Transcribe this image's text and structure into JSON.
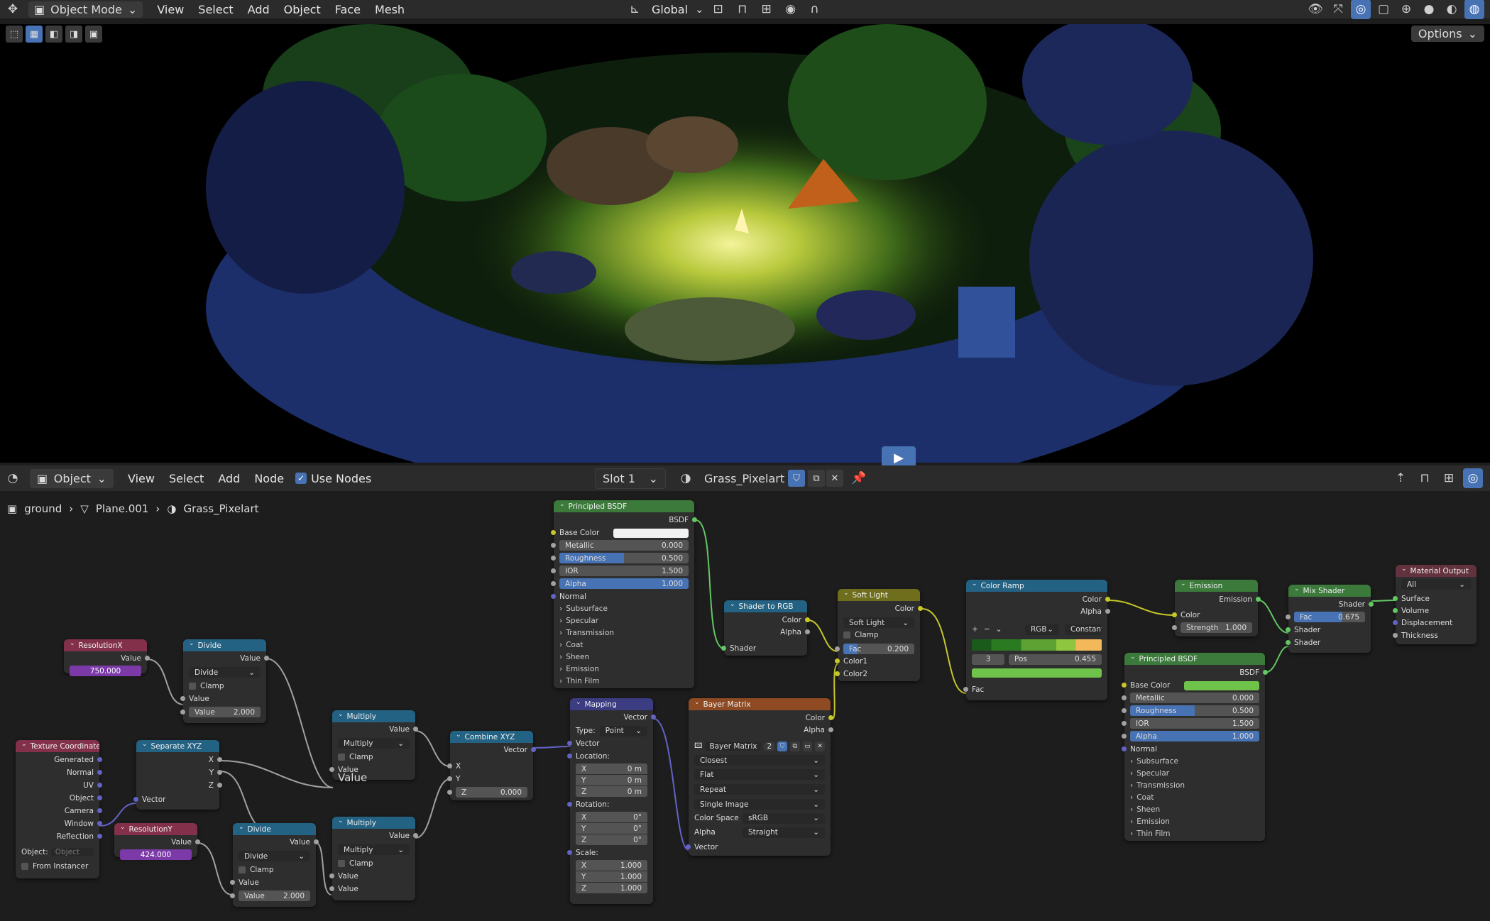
{
  "top_header": {
    "mode": "Object Mode",
    "menus": [
      "View",
      "Select",
      "Add",
      "Object",
      "Face",
      "Mesh"
    ],
    "transform_orientation": "Global",
    "options": "Options"
  },
  "node_header": {
    "mode": "Object",
    "menus": [
      "View",
      "Select",
      "Add",
      "Node"
    ],
    "use_nodes": "Use Nodes",
    "slot": "Slot 1",
    "material": "Grass_Pixelart"
  },
  "breadcrumb": {
    "object": "ground",
    "mesh": "Plane.001",
    "material": "Grass_Pixelart"
  },
  "nodes": {
    "resx": {
      "title": "ResolutionX",
      "out": "Value",
      "value": "750.000"
    },
    "resy": {
      "title": "ResolutionY",
      "out": "Value",
      "value": "424.000"
    },
    "texcoord": {
      "title": "Texture Coordinate",
      "outputs": [
        "Generated",
        "Normal",
        "UV",
        "Object",
        "Camera",
        "Window",
        "Reflection"
      ],
      "object_label": "Object:",
      "object_placeholder": "Object",
      "from_instancer": "From Instancer"
    },
    "sepxyz": {
      "title": "Separate XYZ",
      "outputs": [
        "X",
        "Y",
        "Z"
      ],
      "input": "Vector"
    },
    "div1": {
      "title": "Divide",
      "out": "Value",
      "op": "Divide",
      "clamp": "Clamp",
      "in1": "Value",
      "in2": "Value",
      "val2": "2.000"
    },
    "div2": {
      "title": "Divide",
      "out": "Value",
      "op": "Divide",
      "clamp": "Clamp",
      "in1": "Value",
      "in2": "Value",
      "val2": "2.000"
    },
    "mul1": {
      "title": "Multiply",
      "out": "Value",
      "op": "Multiply",
      "clamp": "Clamp",
      "in1": "Value",
      "in2": "Value"
    },
    "mul2": {
      "title": "Multiply",
      "out": "Value",
      "op": "Multiply",
      "clamp": "Clamp",
      "in1": "Value",
      "in2": "Value"
    },
    "combxyz": {
      "title": "Combine XYZ",
      "out": "Vector",
      "x": "X",
      "y": "Y",
      "z": "Z",
      "zval": "0.000"
    },
    "mapping": {
      "title": "Mapping",
      "out": "Vector",
      "type_label": "Type:",
      "type": "Point",
      "vector": "Vector",
      "location": "Location:",
      "rotation": "Rotation:",
      "scale": "Scale:",
      "loc": [
        "0 m",
        "0 m",
        "0 m"
      ],
      "rot": [
        "0°",
        "0°",
        "0°"
      ],
      "scl": [
        "1.000",
        "1.000",
        "1.000"
      ],
      "axes": [
        "X",
        "Y",
        "Z"
      ]
    },
    "bsdf1": {
      "title": "Principled BSDF",
      "out": "BSDF",
      "base_color": "Base Color",
      "metallic": "Metallic",
      "metallic_v": "0.000",
      "roughness": "Roughness",
      "roughness_v": "0.500",
      "ior": "IOR",
      "ior_v": "1.500",
      "alpha": "Alpha",
      "alpha_v": "1.000",
      "normal": "Normal",
      "panels": [
        "Subsurface",
        "Specular",
        "Transmission",
        "Coat",
        "Sheen",
        "Emission",
        "Thin Film"
      ]
    },
    "s2rgb": {
      "title": "Shader to RGB",
      "color": "Color",
      "alpha": "Alpha",
      "shader": "Shader"
    },
    "bayer": {
      "title": "Bayer Matrix",
      "color": "Color",
      "alpha": "Alpha",
      "image": "Bayer Matrix",
      "users": "2",
      "interp": "Closest",
      "proj": "Flat",
      "ext": "Repeat",
      "source": "Single Image",
      "cs_label": "Color Space",
      "cs": "sRGB",
      "alpha_label": "Alpha",
      "alpha_mode": "Straight",
      "vector": "Vector"
    },
    "softlight": {
      "title": "Soft Light",
      "color": "Color",
      "mode": "Soft Light",
      "clamp": "Clamp",
      "fac": "Fac",
      "fac_v": "0.200",
      "c1": "Color1",
      "c2": "Color2"
    },
    "ramp": {
      "title": "Color Ramp",
      "color": "Color",
      "alpha": "Alpha",
      "plus": "+",
      "minus": "−",
      "mode": "RGB",
      "interp": "Constant",
      "idx": "3",
      "pos_label": "Pos",
      "pos": "0.455",
      "fac": "Fac"
    },
    "emission": {
      "title": "Emission",
      "out": "Emission",
      "color": "Color",
      "strength": "Strength",
      "strength_v": "1.000"
    },
    "bsdf2": {
      "title": "Principled BSDF",
      "out": "BSDF",
      "base_color": "Base Color",
      "metallic": "Metallic",
      "metallic_v": "0.000",
      "roughness": "Roughness",
      "roughness_v": "0.500",
      "ior": "IOR",
      "ior_v": "1.500",
      "alpha": "Alpha",
      "alpha_v": "1.000",
      "normal": "Normal",
      "panels": [
        "Subsurface",
        "Specular",
        "Transmission",
        "Coat",
        "Sheen",
        "Emission",
        "Thin Film"
      ]
    },
    "mix": {
      "title": "Mix Shader",
      "out": "Shader",
      "fac": "Fac",
      "fac_v": "0.675",
      "sh1": "Shader",
      "sh2": "Shader"
    },
    "output": {
      "title": "Material Output",
      "target": "All",
      "surface": "Surface",
      "volume": "Volume",
      "disp": "Displacement",
      "thick": "Thickness"
    }
  },
  "colors": {
    "accent": "#4772b3",
    "input_header": "#83314a",
    "converter_header": "#246283",
    "shader_header": "#3b7a3b",
    "color_header": "#6e6e1d",
    "texture_header": "#8e4a22",
    "vector_header": "#3c3c83",
    "value_field_purple": "#7b3aa8",
    "grass_green": "#6fc24a"
  },
  "icons": {
    "play": "play-icon",
    "pin": "pin-icon",
    "shield": "fake-user-icon",
    "duplicate": "duplicate-icon",
    "close": "close-icon"
  }
}
